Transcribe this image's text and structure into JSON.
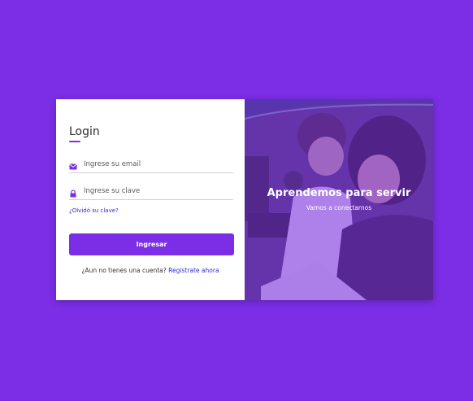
{
  "login": {
    "title": "Login",
    "email_placeholder": "Ingrese su email",
    "password_placeholder": "Ingrese su clave",
    "forgot_link": "¿Olvidó su clave?",
    "submit_label": "Ingresar",
    "signup_prompt": "¿Aun no tienes una cuenta?",
    "signup_link": "Registrate ahora"
  },
  "hero": {
    "title": "Aprendemos para servir",
    "subtitle": "Vamos a conectarnos"
  },
  "colors": {
    "accent": "#7b2ee6",
    "link": "#2a2ad9"
  },
  "icons": {
    "email": "envelope-icon",
    "password": "lock-icon"
  }
}
